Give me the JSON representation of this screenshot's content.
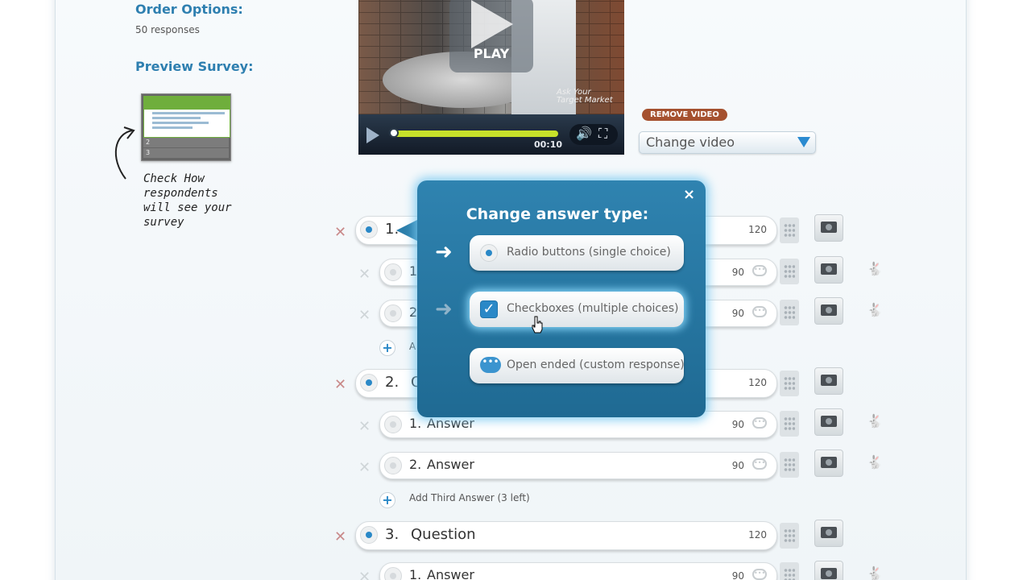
{
  "sidebar": {
    "order_options_title": "Order Options:",
    "responses": "50 responses",
    "preview_title": "Preview Survey:",
    "preview_rows": [
      "2",
      "3"
    ],
    "note_lines": [
      "Check How",
      "respondents",
      "will see your",
      "survey"
    ]
  },
  "video": {
    "play_label": "PLAY",
    "time": "00:10",
    "watermark": "Ask Your Target Market",
    "remove_label": "REMOVE VIDEO",
    "change_label": "Change video",
    "progress": 0.0
  },
  "popup": {
    "title": "Change answer type:",
    "close": "×",
    "options": [
      {
        "label": "Radio buttons (single choice)",
        "icon": "radio-icon"
      },
      {
        "label": "Checkboxes (multiple choices)",
        "icon": "checkbox-icon"
      },
      {
        "label": "Open ended (custom response)",
        "icon": "speech-bubble-icon"
      }
    ]
  },
  "survey": {
    "q1": {
      "number": "1.",
      "count": "120",
      "answers": [
        {
          "num": "1",
          "count": "90"
        },
        {
          "num": "2",
          "count": "90"
        }
      ],
      "add_label": "A"
    },
    "q2": {
      "number": "2.",
      "label": "Q",
      "count": "120",
      "answers": [
        {
          "num": "1.",
          "label": "Answer",
          "count": "90"
        },
        {
          "num": "2.",
          "label": "Answer",
          "count": "90"
        }
      ],
      "add_label": "Add Third Answer (3 left)"
    },
    "q3": {
      "number": "3.",
      "label": "Question",
      "count": "120",
      "answers": [
        {
          "num": "1.",
          "label": "Answer",
          "count": "90"
        }
      ]
    }
  },
  "colors": {
    "accent": "#2a88c7",
    "popup": "#2378a5",
    "remove": "#a5512f",
    "progress": "#c7e12a"
  }
}
